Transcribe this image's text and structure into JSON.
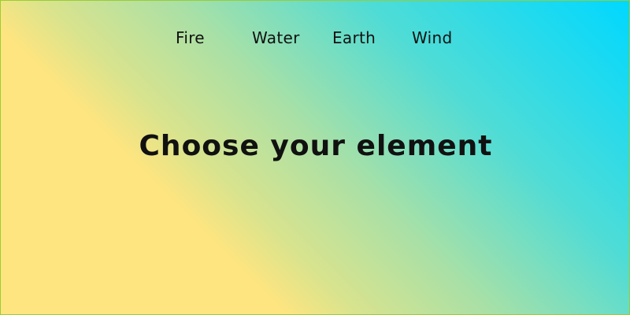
{
  "nav": {
    "items": [
      {
        "label": "Fire"
      },
      {
        "label": "Water"
      },
      {
        "label": "Earth"
      },
      {
        "label": "Wind"
      }
    ]
  },
  "hero": {
    "title": "Choose your element"
  },
  "colors": {
    "gradient_start": "#00d8ff",
    "gradient_end": "#ffe57f",
    "border": "#9acd32",
    "text": "#111111"
  }
}
